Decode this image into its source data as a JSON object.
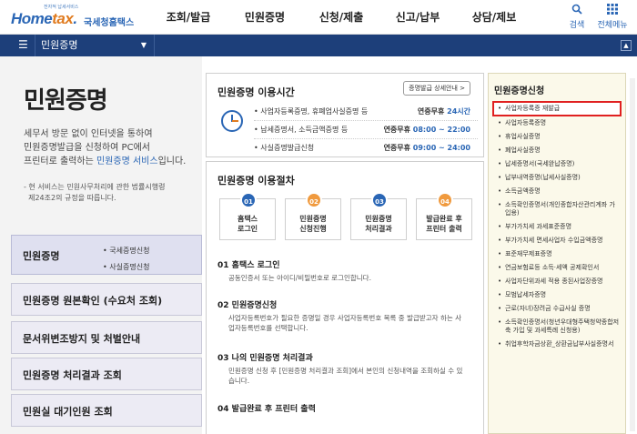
{
  "header": {
    "logo_small": "전자적 납세서비스",
    "logo_main": "Hometax",
    "logo_sub": "국세청홈택스",
    "nav": [
      "조회/발급",
      "민원증명",
      "신청/제출",
      "신고/납부",
      "상담/제보"
    ],
    "search_label": "검색",
    "allmenu_label": "전체메뉴"
  },
  "subbar": {
    "crumb": "민원증명"
  },
  "left": {
    "title": "민원증명",
    "intro_1": "세무서 방문 없이 인터넷을 통하여",
    "intro_2": "민원증명발급을 신청하여 PC에서",
    "intro_3a": "프린터로 출력하는 ",
    "intro_3b": "민원증명 서비스",
    "intro_3c": "입니다.",
    "note_1": "- 현 서비스는 민원사무처리에 관한 법률시행령",
    "note_2": "  제24조2의 규정을 따릅니다.",
    "nav": [
      {
        "label": "민원증명",
        "subs": [
          "국세증명신청",
          "사실증명신청"
        ]
      },
      {
        "label": "민원증명 원본확인 (수요처 조회)"
      },
      {
        "label": "문서위변조방지 및 처벌안내"
      },
      {
        "label": "민원증명 처리결과 조회"
      },
      {
        "label": "민원실 대기인원 조회"
      }
    ]
  },
  "hours": {
    "title": "민원증명 이용시간",
    "button": "증명발급 상세안내 >",
    "rows": [
      {
        "name": "사업자등록증명, 휴폐업사실증명 등",
        "prefix": "연중무휴 ",
        "time": "24시간"
      },
      {
        "name": "납세증명서, 소득금액증명 등",
        "prefix": "연중무휴 ",
        "time": "08:00 ~ 22:00"
      },
      {
        "name": "사실증명발급신청",
        "prefix": "연중무휴 ",
        "time": "09:00 ~ 24:00"
      }
    ]
  },
  "procedure": {
    "title": "민원증명 이용절차",
    "steps": [
      {
        "num": "01",
        "l1": "홈택스",
        "l2": "로그인",
        "color": "#2a66b5"
      },
      {
        "num": "02",
        "l1": "민원증명",
        "l2": "신청진행",
        "color": "#f09a3e"
      },
      {
        "num": "03",
        "l1": "민원증명",
        "l2": "처리결과",
        "color": "#2a66b5"
      },
      {
        "num": "04",
        "l1": "발급완료 후",
        "l2": "프린터 출력",
        "color": "#f09a3e"
      }
    ],
    "details": [
      {
        "h": "01 홈택스 로그인",
        "d": "공동인증서 또는 아이디/비밀번호로 로그인합니다."
      },
      {
        "h": "02 민원증명신청",
        "d": "사업자등록번호가 필요한 증명일 경우 사업자등록번호 목록 중 발급받고자 하는 사업자등록번호를 선택합니다."
      },
      {
        "h": "03 나의 민원증명 처리결과",
        "d": "민원증명 신청 후 [민원증명 처리결과 조회]에서 본인의 신청내역을 조회하실 수 있습니다."
      },
      {
        "h": "04 발급완료 후 프린터 출력",
        "d": ""
      }
    ]
  },
  "right": {
    "title": "민원증명신청",
    "items": [
      "사업자등록증 재발급",
      "사업자등록증명",
      "휴업사실증명",
      "폐업사실증명",
      "납세증명서(국세완납증명)",
      "납부내역증명(납세사실증명)",
      "소득금액증명",
      "소득확인증명서(개인종합자산관리계좌 가입용)",
      "부가가치세 과세표준증명",
      "부가가치세 면세사업자 수입금액증명",
      "표준재무제표증명",
      "연금보험료등 소득·세액 공제확인서",
      "사업자단위과세 적용 종된사업장증명",
      "모범납세자증명",
      "근로(자녀)장려금 수급사실 증명",
      "소득확인증명서(청년우대형주택청약종합저축 가입 및 과세특례 신청용)",
      "취업후학자금상환_상환금납부사실증명서"
    ]
  }
}
